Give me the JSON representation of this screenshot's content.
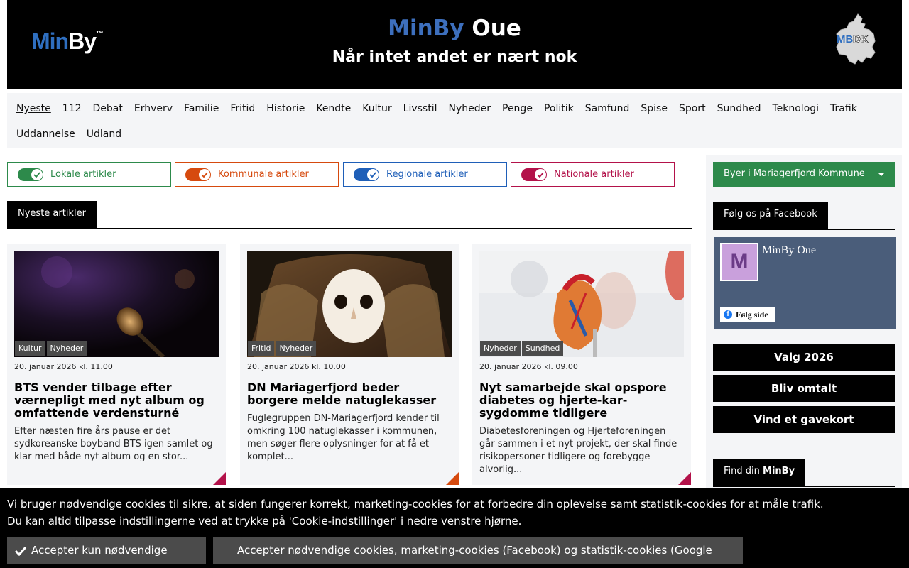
{
  "header": {
    "logo_min": "MinBy",
    "logo_tm": "™",
    "title_brand": "MinBy",
    "title_city": "Oue",
    "subtitle": "Når intet andet er nært nok",
    "badge_text": "MBDK"
  },
  "nav": {
    "items": [
      "Nyeste",
      "112",
      "Debat",
      "Erhverv",
      "Familie",
      "Fritid",
      "Historie",
      "Kendte",
      "Kultur",
      "Livsstil",
      "Nyheder",
      "Penge",
      "Politik",
      "Samfund",
      "Spise",
      "Sport",
      "Sundhed",
      "Teknologi",
      "Trafik",
      "Uddannelse",
      "Udland"
    ],
    "active": "Nyeste"
  },
  "filters": [
    {
      "label": "Lokale artikler",
      "color": "#2d8a4b"
    },
    {
      "label": "Kommunale artikler",
      "color": "#d64a0e"
    },
    {
      "label": "Regionale artikler",
      "color": "#1f5fb8"
    },
    {
      "label": "Nationale artikler",
      "color": "#b3124a"
    }
  ],
  "section_tab": "Nyeste artikler",
  "articles": [
    {
      "tags": [
        "Kultur",
        "Nyheder"
      ],
      "date": "20. januar 2026 kl. 11.00",
      "title": "BTS vender tilbage efter værnepligt med nyt album og omfattende verdensturné",
      "excerpt": "Efter næsten fire års pause er det sydkoreanske boyband BTS igen samlet og klar med både nyt album og en stor...",
      "corner_color": "#b3124a"
    },
    {
      "tags": [
        "Fritid",
        "Nyheder"
      ],
      "date": "20. januar 2026 kl. 10.00",
      "title": "DN Mariagerfjord beder borgere melde natuglekasser",
      "excerpt": "Fuglegruppen DN-Mariagerfjord kender til omkring 100 natuglekasser i kommunen, men søger flere oplysninger for at få et komplet...",
      "corner_color": "#d64a0e"
    },
    {
      "tags": [
        "Nyheder",
        "Sundhed"
      ],
      "date": "20. januar 2026 kl. 09.00",
      "title": "Nyt samarbejde skal opspore diabetes og hjerte-kar-sygdomme tidligere",
      "excerpt": "Diabetesforeningen og Hjerteforeningen går sammen i et nyt projekt, der skal finde risikopersoner tidligere og forebygge alvorlig...",
      "corner_color": "#b3124a"
    }
  ],
  "sidebar": {
    "dropdown": "Byer i Mariagerfjord Kommune",
    "facebook_tab": "Følg os på Facebook",
    "fb_avatar_letter": "M",
    "fb_page_name": "MinBy Oue",
    "fb_follow": "Følg side",
    "buttons": [
      "Valg 2026",
      "Bliv omtalt",
      "Vind et gavekort"
    ],
    "find_tab_prefix": "Find din",
    "find_tab_brand": "MinBy"
  },
  "cookie": {
    "line1": "Vi bruger nødvendige cookies til sikre, at siden fungerer korrekt, marketing-cookies for at forbedre din oplevelse samt statistik-cookies for at måle trafik.",
    "line2": "Du kan altid tilpasse indstillingerne ved at trykke på 'Cookie-indstillinger' i nedre venstre hjørne.",
    "btn_necessary": "Accepter kun nødvendige cookies",
    "btn_all": "Accepter nødvendige cookies, marketing-cookies (Facebook) og statistik-cookies (Google Analytics)"
  }
}
